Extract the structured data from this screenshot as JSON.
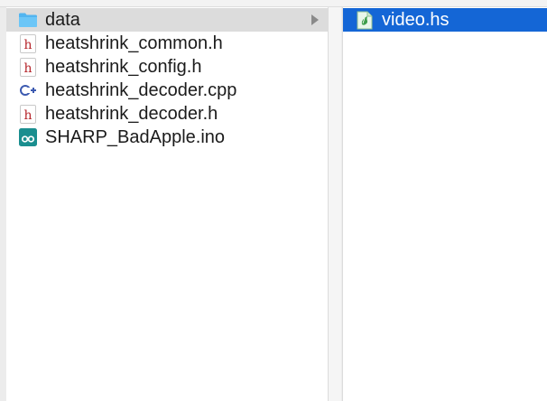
{
  "columns": [
    {
      "items": [
        {
          "label": "data",
          "icon": "folder-icon",
          "kind": "folder",
          "selected": "inactive",
          "has_children": true
        },
        {
          "label": "heatshrink_common.h",
          "icon": "header-file-icon",
          "kind": "h",
          "selected": "none"
        },
        {
          "label": "heatshrink_config.h",
          "icon": "header-file-icon",
          "kind": "h",
          "selected": "none"
        },
        {
          "label": "heatshrink_decoder.cpp",
          "icon": "cpp-file-icon",
          "kind": "cpp",
          "selected": "none"
        },
        {
          "label": "heatshrink_decoder.h",
          "icon": "header-file-icon",
          "kind": "h",
          "selected": "none"
        },
        {
          "label": "SHARP_BadApple.ino",
          "icon": "arduino-file-icon",
          "kind": "ino",
          "selected": "none"
        }
      ]
    },
    {
      "items": [
        {
          "label": "video.hs",
          "icon": "document-icon",
          "kind": "hs",
          "selected": "active"
        }
      ]
    }
  ],
  "colors": {
    "selection_active": "#1466d6",
    "selection_inactive": "#dcdcdc",
    "folder": "#52b5f0",
    "header_red": "#b5242a",
    "cpp_blue": "#3c5ab0",
    "arduino_teal": "#1a8e8f"
  }
}
